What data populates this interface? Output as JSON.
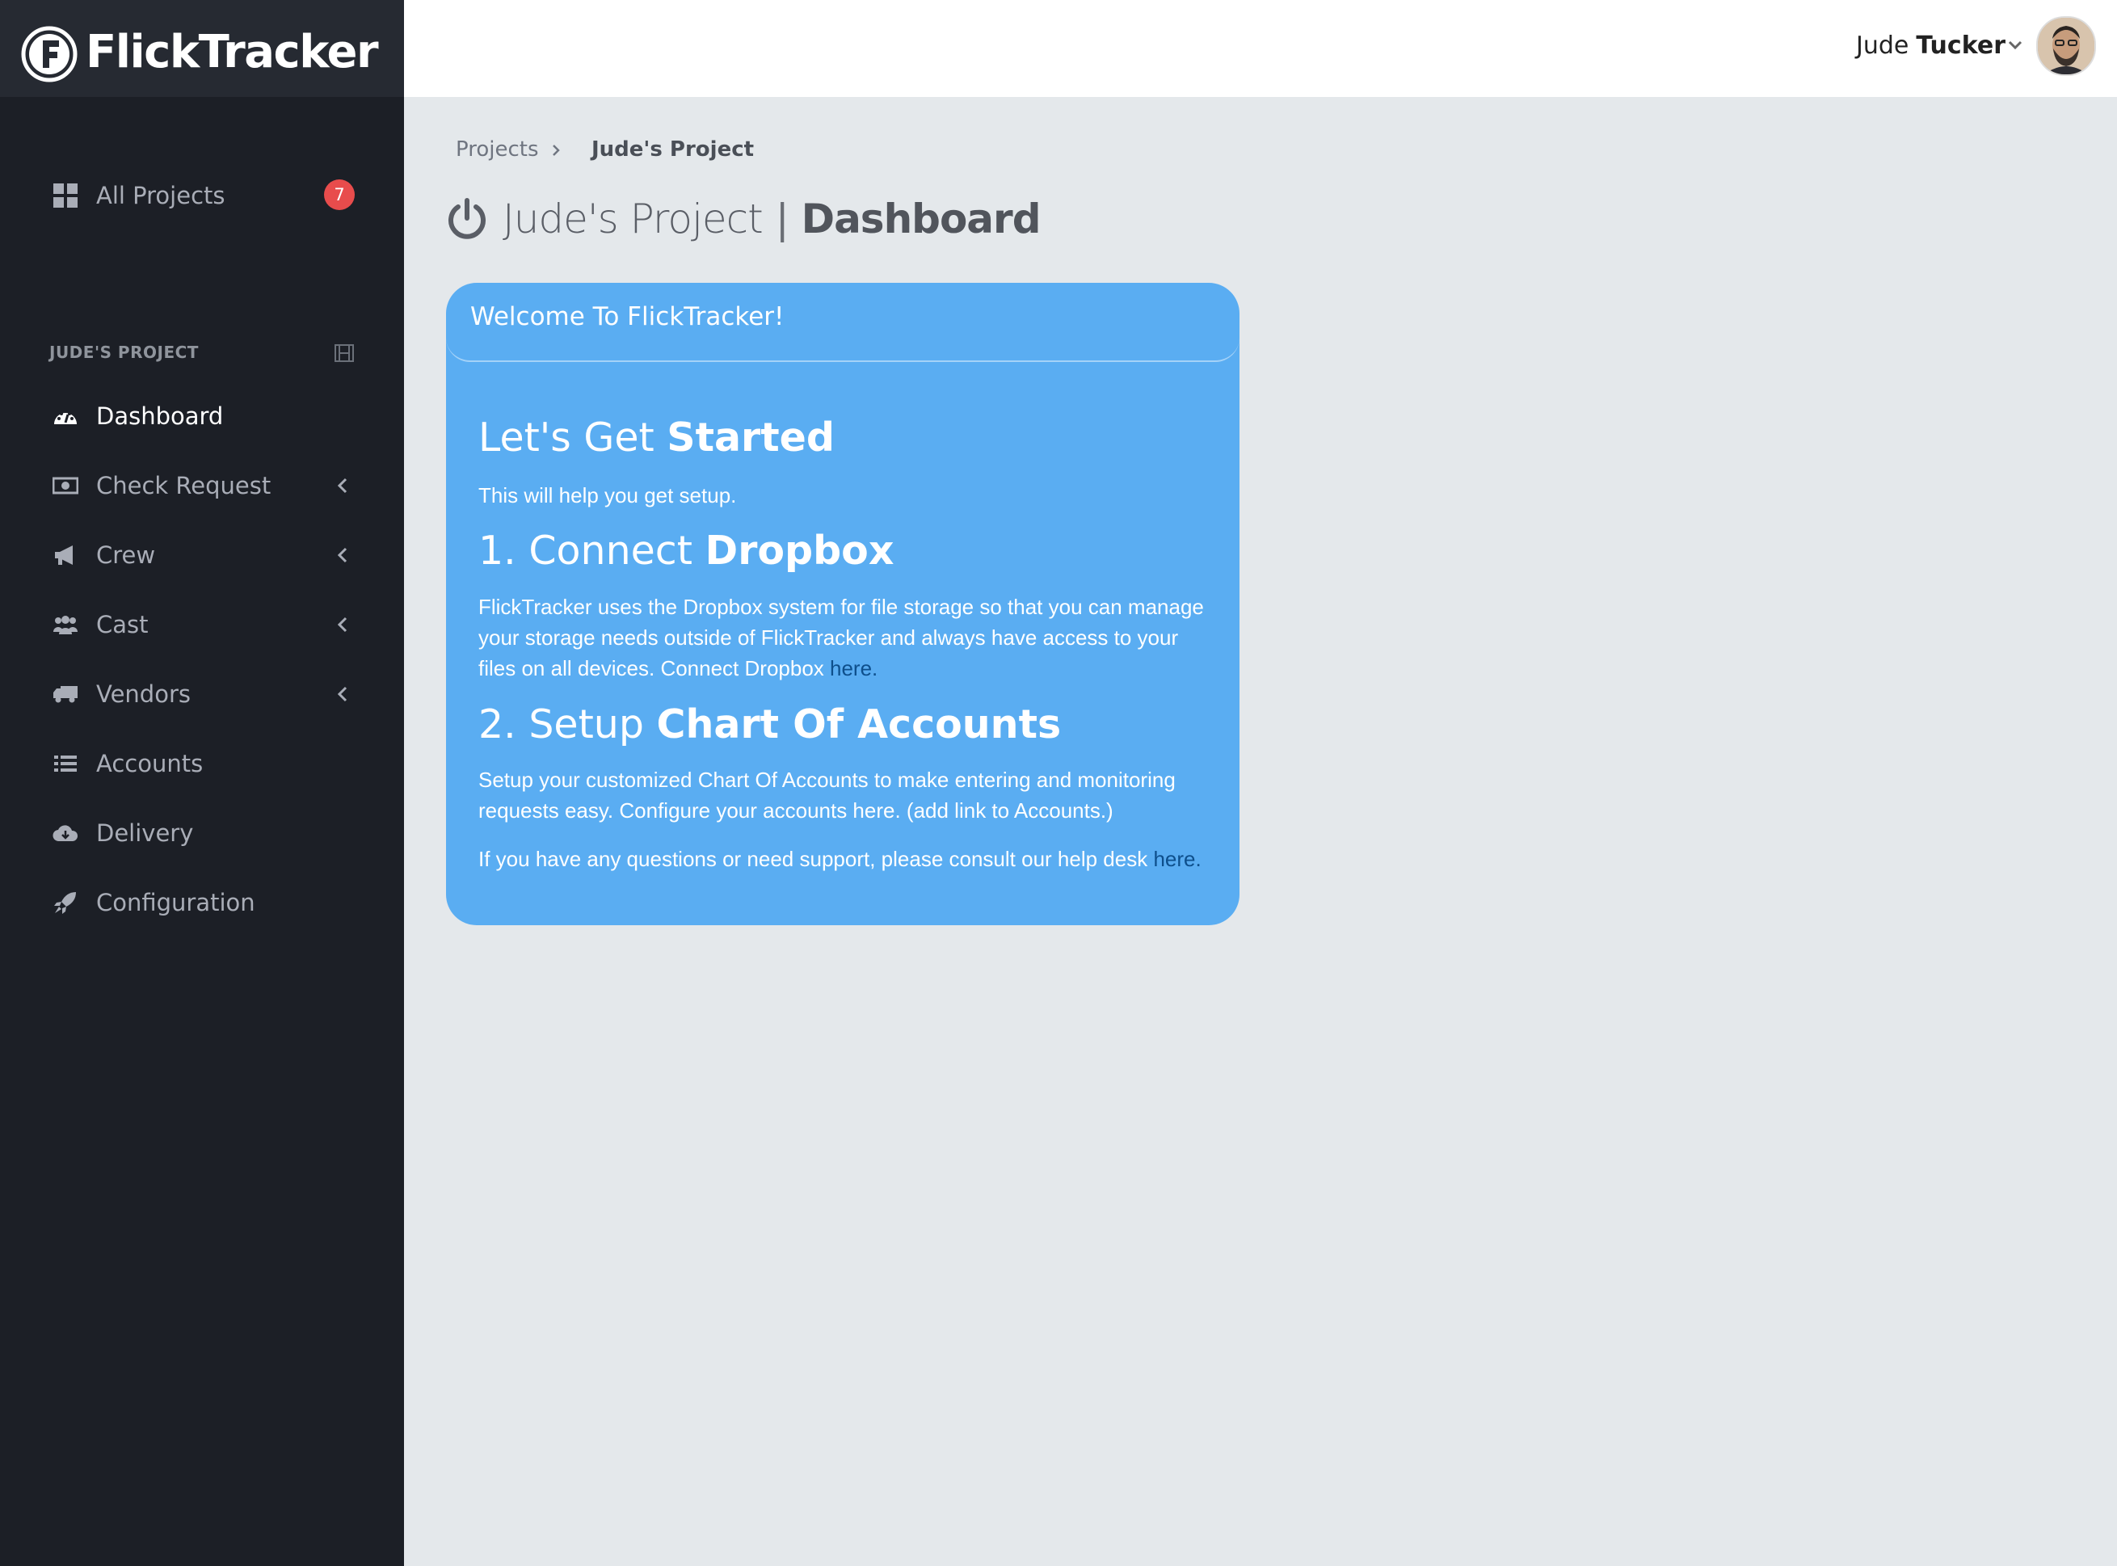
{
  "brand": {
    "name": "FlickTracker"
  },
  "sidebar": {
    "all_projects": {
      "label": "All Projects",
      "badge": "7"
    },
    "section_title": "JUDE'S PROJECT",
    "items": [
      {
        "label": "Dashboard",
        "icon": "dashboard-icon",
        "active": true
      },
      {
        "label": "Check Request",
        "icon": "money-icon",
        "has_submenu": true
      },
      {
        "label": "Crew",
        "icon": "megaphone-icon",
        "has_submenu": true
      },
      {
        "label": "Cast",
        "icon": "users-icon",
        "has_submenu": true
      },
      {
        "label": "Vendors",
        "icon": "truck-icon",
        "has_submenu": true
      },
      {
        "label": "Accounts",
        "icon": "list-icon"
      },
      {
        "label": "Delivery",
        "icon": "cloud-download-icon"
      },
      {
        "label": "Configuration",
        "icon": "rocket-icon"
      }
    ]
  },
  "header": {
    "user": {
      "first_name": "Jude",
      "last_name": "Tucker"
    }
  },
  "breadcrumb": {
    "parent": "Projects",
    "current": "Jude's Project"
  },
  "page": {
    "project": "Jude's Project",
    "divider": "|",
    "section": "Dashboard"
  },
  "welcome": {
    "title": "Welcome To FlickTracker!",
    "getting_started": {
      "light": "Let's Get",
      "bold": "Started"
    },
    "intro": "This will help you get setup.",
    "step1": {
      "light": "1. Connect",
      "bold": "Dropbox",
      "text": "FlickTracker uses the Dropbox system for file storage so that you can manage your storage needs outside of FlickTracker and always have access to your files on all devices. Connect Dropbox",
      "link": "here."
    },
    "step2": {
      "light": "2. Setup",
      "bold": "Chart Of Accounts",
      "text": "Setup your customized Chart Of Accounts to make entering and monitoring requests easy. Configure your accounts here. (add link to Accounts.)"
    },
    "support": {
      "text": "If you have any questions or need support, please consult our help desk",
      "link": "here."
    }
  },
  "colors": {
    "sidebar_bg": "#1c1f26",
    "brand_bg": "#262a32",
    "card_bg": "#5aadf2",
    "badge_bg": "#e84c4c",
    "link": "#0e4f8c"
  }
}
